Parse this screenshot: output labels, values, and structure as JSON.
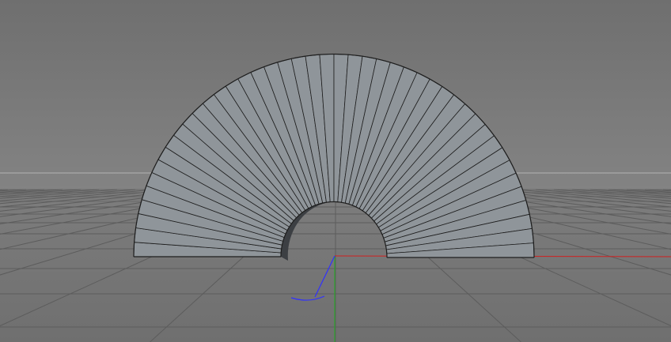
{
  "app": {
    "viewport_type": "3d-perspective-viewport"
  },
  "colors": {
    "sky_top": "#6f6f6f",
    "sky_bottom": "#838383",
    "floor_near": "#6f6f6f",
    "floor_far": "#7d7d7d",
    "horizon_line": "#b4b4b4",
    "grid_line": "#5c5c5c",
    "grid_line_far": "#6a6a6a",
    "object_face": "#8f959a",
    "object_edge": "#1e1e1e",
    "object_inner_shadow": "#3c3f43",
    "axis_x": "#d02020",
    "axis_y": "#20b020",
    "axis_z": "#3030ff"
  },
  "scene": {
    "objects": [
      {
        "name": "half-ring",
        "type": "half-annulus",
        "segments": 44,
        "selected": false
      }
    ],
    "world_axes": {
      "show_x": true,
      "show_y": true,
      "show_z": true
    },
    "grid_visible": true
  }
}
